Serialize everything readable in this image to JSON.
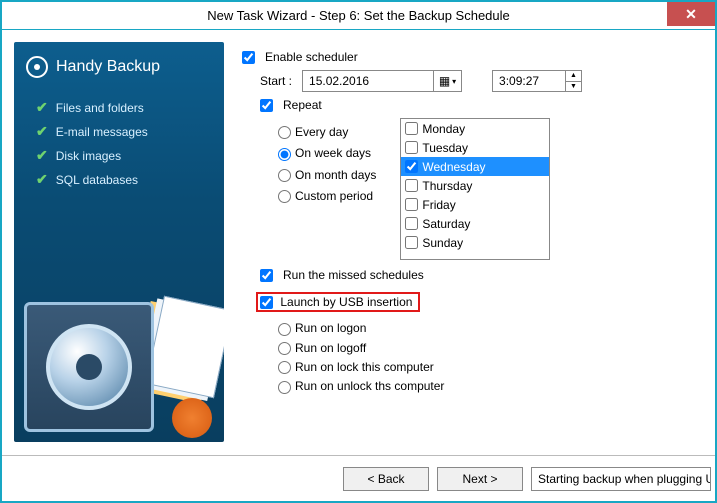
{
  "window": {
    "title": "New Task Wizard - Step 6: Set the Backup Schedule",
    "close_glyph": "✕"
  },
  "sidebar": {
    "brand": "Handy Backup",
    "features": [
      "Files and folders",
      "E-mail messages",
      "Disk images",
      "SQL databases"
    ]
  },
  "schedule": {
    "enable_label": "Enable scheduler",
    "enable_checked": true,
    "start_label": "Start :",
    "date_value": "15.02.2016",
    "time_value": "3:09:27",
    "repeat_label": "Repeat",
    "repeat_checked": true,
    "freq_options": {
      "every_day": "Every day",
      "week_days": "On week days",
      "month_days": "On month days",
      "custom": "Custom period"
    },
    "freq_selected": "week_days",
    "days": [
      {
        "label": "Monday",
        "checked": false,
        "selected": false
      },
      {
        "label": "Tuesday",
        "checked": false,
        "selected": false
      },
      {
        "label": "Wednesday",
        "checked": true,
        "selected": true
      },
      {
        "label": "Thursday",
        "checked": false,
        "selected": false
      },
      {
        "label": "Friday",
        "checked": false,
        "selected": false
      },
      {
        "label": "Saturday",
        "checked": false,
        "selected": false
      },
      {
        "label": "Sunday",
        "checked": false,
        "selected": false
      }
    ],
    "run_missed_label": "Run the missed schedules",
    "run_missed_checked": true
  },
  "launch": {
    "usb_label": "Launch by USB insertion",
    "usb_checked": true,
    "options": {
      "logon": "Run on logon",
      "logoff": "Run on logoff",
      "lock": "Run on lock this computer",
      "unlock": "Run on unlock ths computer"
    },
    "selected": ""
  },
  "footer": {
    "back_label": "< Back",
    "next_label": "Next >",
    "tooltip": "Starting backup when plugging USB"
  }
}
